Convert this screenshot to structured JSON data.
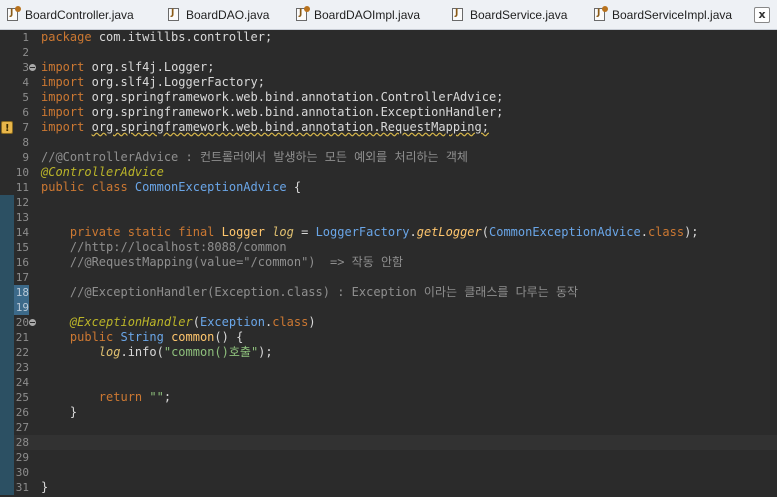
{
  "tabs": [
    {
      "label": "BoardController.java",
      "kind": "java"
    },
    {
      "label": "BoardDAO.java",
      "kind": "interface"
    },
    {
      "label": "BoardDAOImpl.java",
      "kind": "java"
    },
    {
      "label": "BoardService.java",
      "kind": "interface"
    },
    {
      "label": "BoardServiceImpl.java",
      "kind": "java"
    }
  ],
  "close_label": "x",
  "editor": {
    "current_line": 28,
    "selected_lines": [
      18,
      19
    ],
    "lines": [
      {
        "n": "1",
        "t": [
          [
            "kw",
            "package"
          ],
          [
            "",
            "com.itwillbs.controller;"
          ]
        ]
      },
      {
        "n": "2",
        "t": []
      },
      {
        "n": "3",
        "fold": true,
        "t": [
          [
            "kw",
            "import"
          ],
          [
            "",
            "org.slf4j.Logger;"
          ]
        ]
      },
      {
        "n": "4",
        "t": [
          [
            "kw",
            "import"
          ],
          [
            "",
            "org.slf4j.LoggerFactory;"
          ]
        ]
      },
      {
        "n": "5",
        "t": [
          [
            "kw",
            "import"
          ],
          [
            "",
            "org.springframework.web.bind.annotation.ControllerAdvice;"
          ]
        ]
      },
      {
        "n": "6",
        "t": [
          [
            "kw",
            "import"
          ],
          [
            "",
            "org.springframework.web.bind.annotation.ExceptionHandler;"
          ]
        ]
      },
      {
        "n": "7",
        "warn": true,
        "t": [
          [
            "kw",
            "import"
          ],
          [
            "und",
            "org.springframework.web.bind.annotation.RequestMapping;"
          ]
        ]
      },
      {
        "n": "8",
        "t": []
      },
      {
        "n": "9",
        "t": [
          [
            "cm",
            "//@ControllerAdvice : 컨트롤러에서 발생하는 모든 예외를 처리하는 객체"
          ]
        ]
      },
      {
        "n": "10",
        "t": [
          [
            "an",
            "@ControllerAdvice"
          ]
        ]
      },
      {
        "n": "11",
        "t": [
          [
            "kw",
            "public class "
          ],
          [
            "ty",
            "CommonExceptionAdvice"
          ],
          [
            "",
            " {"
          ]
        ]
      },
      {
        "n": "12",
        "t": []
      },
      {
        "n": "13",
        "t": []
      },
      {
        "n": "14",
        "t": [
          [
            "",
            "    "
          ],
          [
            "kw",
            "private static final "
          ],
          [
            "mt",
            "Logger "
          ],
          [
            "fd",
            "log"
          ],
          [
            "",
            " = "
          ],
          [
            "ty",
            "LoggerFactory"
          ],
          [
            "",
            "."
          ],
          [
            "sm",
            "getLogger"
          ],
          [
            "",
            "("
          ],
          [
            "ty",
            "CommonExceptionAdvice"
          ],
          [
            "",
            "."
          ],
          [
            "kw",
            "class"
          ],
          [
            "",
            ");"
          ]
        ]
      },
      {
        "n": "15",
        "t": [
          [
            "cm",
            "    //http://localhost:8088/common"
          ]
        ]
      },
      {
        "n": "16",
        "t": [
          [
            "cm",
            "    //@RequestMapping(value=\"/common\")  => 작동 안함"
          ]
        ]
      },
      {
        "n": "17",
        "t": []
      },
      {
        "n": "18",
        "t": [
          [
            "cm",
            "    //@ExceptionHandler(Exception.class) : Exception 이라는 클래스를 다루는 동작"
          ]
        ]
      },
      {
        "n": "19",
        "t": []
      },
      {
        "n": "20",
        "fold": true,
        "t": [
          [
            "",
            "    "
          ],
          [
            "an",
            "@ExceptionHandler"
          ],
          [
            "",
            "("
          ],
          [
            "ty",
            "Exception"
          ],
          [
            "",
            "."
          ],
          [
            "kw",
            "class"
          ],
          [
            "",
            ")"
          ]
        ]
      },
      {
        "n": "21",
        "t": [
          [
            "",
            "    "
          ],
          [
            "kw",
            "public "
          ],
          [
            "ty",
            "String "
          ],
          [
            "mt",
            "common"
          ],
          [
            "",
            "() {"
          ]
        ]
      },
      {
        "n": "22",
        "t": [
          [
            "",
            "        "
          ],
          [
            "fd",
            "log"
          ],
          [
            "",
            ".info("
          ],
          [
            "st",
            "\"common()호출\""
          ],
          [
            "",
            ");"
          ]
        ]
      },
      {
        "n": "23",
        "t": []
      },
      {
        "n": "24",
        "t": []
      },
      {
        "n": "25",
        "t": [
          [
            "",
            "        "
          ],
          [
            "kw",
            "return "
          ],
          [
            "st",
            "\"\""
          ],
          [
            "",
            ";"
          ]
        ]
      },
      {
        "n": "26",
        "t": [
          [
            "",
            "    }"
          ]
        ]
      },
      {
        "n": "27",
        "t": []
      },
      {
        "n": "28",
        "t": []
      },
      {
        "n": "29",
        "t": []
      },
      {
        "n": "30",
        "t": []
      },
      {
        "n": "31",
        "t": [
          [
            "",
            "}"
          ]
        ]
      }
    ]
  },
  "colors": {
    "background": "#2b2b2b",
    "keyword": "#cc7832",
    "type": "#6aa6e8",
    "annotation": "#bbb529",
    "comment": "#8f8f8f",
    "string": "#8ec07c"
  }
}
